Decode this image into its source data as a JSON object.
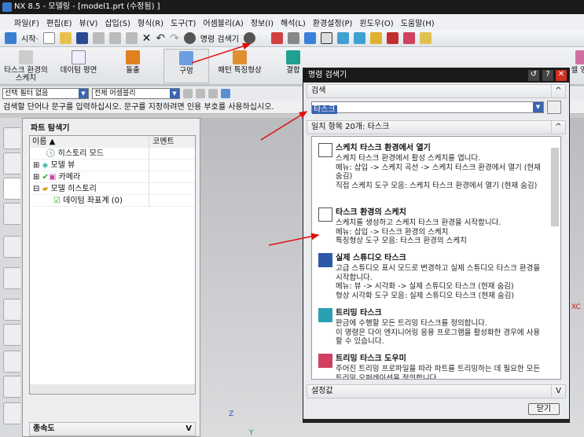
{
  "window": {
    "title": "NX 8.5 - 모델링 - [model1.prt (수정됨) ]"
  },
  "menu": [
    "파일(F)",
    "편집(E)",
    "뷰(V)",
    "삽입(S)",
    "형식(R)",
    "도구(T)",
    "어셈블리(A)",
    "정보(I)",
    "해석(L)",
    "환경설정(P)",
    "윈도우(O)",
    "도움말(H)"
  ],
  "toolbar": {
    "start": "시작·",
    "command_finder": "명령 검색기"
  },
  "ribbon": [
    {
      "label": "타스크 환경의 스케치"
    },
    {
      "label": "데이텀 평면"
    },
    {
      "label": "돌출"
    },
    {
      "label": "구멍"
    },
    {
      "label": "패턴 특징형상"
    },
    {
      "label": "결합"
    },
    {
      "label": "셀 영역"
    }
  ],
  "selection": {
    "filter": "선택 필터 없음",
    "scope": "전체 어셈블리"
  },
  "hint": "검색할 단어나 문구를 입력하십시오. 문구를 지정하려면 인용 부호를 사용하십시오.",
  "navigator": {
    "title": "파트 탐색기",
    "col_name": "이름",
    "col_comment": "코멘트",
    "rows": [
      "히스토리 모드",
      "모델 뷰",
      "카메라",
      "모델 히스토리",
      "데이텀 좌표계 (0)"
    ],
    "dependency": "종속도"
  },
  "dialog": {
    "title": "명령 검색기",
    "search_section": "검색",
    "search_value": "타스크",
    "results_header": "일치 항목 20개: 타스크",
    "results": [
      {
        "title": "스케치 타스크 환경에서 열기",
        "desc": "스케치 타스크 환경에서 활성 스케치를 엽니다.\n메뉴: 삽입 -> 스케치 곡선 -> 스케치 타스크 환경에서 열기 (현재 숨김)\n직접 스케치 도구 모음: 스케치 타스크 환경에서 열기 (현재 숨김)"
      },
      {
        "title": "타스크 환경의 스케치",
        "desc": "스케치를 생성하고 스케치 타스크 환경을 시작합니다.\n메뉴: 삽입 -> 타스크 환경의 스케치\n특징형상 도구 모음: 타스크 환경의 스케치"
      },
      {
        "title": "실제 스튜디오 타스크",
        "desc": "고급 스튜디오 표시 모드로 변경하고 실제 스튜디오 타스크 환경을 시작합니다.\n메뉴: 뷰 -> 시각화 -> 실제 스튜디오 타스크 (현재 숨김)\n형상 시각화 도구 모음: 실제 스튜디오 타스크 (현재 숨김)"
      },
      {
        "title": "트리밍 타스크",
        "desc": "판금에 수행할 모든 트리밍 타스크를 정의합니다.\n이 명령은 다이 엔지니어링 응용 프로그램을 활성화한 경우에 사용할 수 있습니다."
      },
      {
        "title": "트리밍 타스크 도우미",
        "desc": "주어진 트리밍 프로파일을 따라 파트를 트리밍하는 데 필요한 모든 트리밍 오퍼레이션을 정의합니다."
      }
    ],
    "settings_section": "설정값",
    "close": "닫기"
  },
  "axes": {
    "z": "Z",
    "y": "Y",
    "xc": "XC"
  },
  "colors": {
    "titlebar": "#1a1a1a",
    "annotation_arrow": "#e01010",
    "selection": "#3a64b0"
  }
}
